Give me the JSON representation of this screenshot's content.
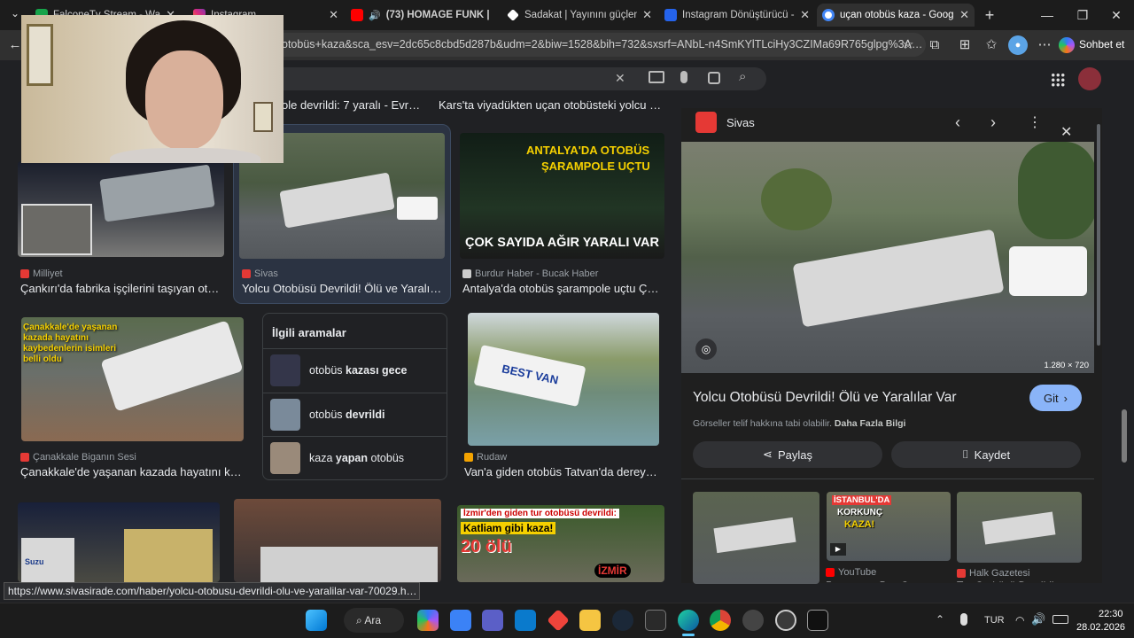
{
  "tabs": [
    {
      "title": "FalconeTv Stream - Watch L...",
      "color": "#16a34a"
    },
    {
      "title": "Instagram",
      "color": "#e1306c"
    },
    {
      "title": "(73) HOMAGE FUNK | T...",
      "color": "#ff0000"
    },
    {
      "title": "Sadakat | Yayınını güçlendirme...",
      "color": "#ffffff"
    },
    {
      "title": "Instagram Dönüştürücü - Insta...",
      "color": "#2563eb"
    },
    {
      "title": "uçan otobüs kaza - Google'da...",
      "color": "#4285f4"
    }
  ],
  "window_controls": {
    "minimize": "—",
    "maximize": "❐",
    "close": "✕"
  },
  "address": {
    "url": "otobüs+kaza&sca_esv=2dc65c8cbd5d287b&udm=2&biw=1528&bih=732&sxsrf=ANbL-n4SmKYlTLciHy3CZIMa69R765glpg%3A1772..."
  },
  "toolbar": {
    "sohbet_label": "Sohbet et"
  },
  "results_top": [
    {
      "title": "ole devrildi: 7 yaralı - Evre..."
    },
    {
      "title": "Kars'ta viyadükten uçan otobüsteki yolcu o a..."
    }
  ],
  "results": [
    {
      "source": "Milliyet",
      "title": "Çankırı'da fabrika işçilerini taşıyan otob...",
      "source_color": "#e53935"
    },
    {
      "source": "Sivas",
      "title": "Yolcu Otobüsü Devrildi! Ölü ve Yaralılar ...",
      "source_color": "#e53935"
    },
    {
      "source": "Burdur Haber - Bucak Haber",
      "title": "Antalya'da otobüs şarampole uçtu Çok ...",
      "source_color": "#cccccc"
    },
    {
      "source": "Çanakkale Biganın Sesi",
      "title": "Çanakkale'de yaşanan kazada hayatını kayb...",
      "source_color": "#e53935"
    },
    {
      "source": "Rudaw",
      "title": "Van'a giden otobüs Tatvan'da dereye u...",
      "source_color": "#f4a300"
    }
  ],
  "thumb_texts": {
    "antalya_top": "ANTALYA'DA OTOBÜS",
    "antalya_mid": "ŞARAMPOLE UÇTU",
    "antalya_bottom": "ÇOK SAYIDA AĞIR YARALI VAR",
    "canakkale": "Çanakkale'de yaşanan kazada hayatını kaybedenlerin isimleri belli oldu",
    "izmir_top": "İzmir'den giden tur otobüsü devrildi:",
    "izmir_mid": "Katliam gibi kaza!",
    "izmir_count": "20 ölü",
    "izmir_logo": "İZMİR",
    "van_bus": "BEST VAN",
    "suzu": "Suzu"
  },
  "related": {
    "heading": "İlgili aramalar",
    "items": [
      {
        "pre": "otobüs ",
        "bold": "kazası gece",
        "post": ""
      },
      {
        "pre": "otobüs ",
        "bold": "devrildi",
        "post": ""
      },
      {
        "pre": "kaza ",
        "bold": "yapan",
        "post": " otobüs"
      }
    ]
  },
  "panel": {
    "source": "Sivas",
    "dims": "1.280 × 720",
    "title": "Yolcu Otobüsü Devrildi! Ölü ve Yaralılar Var",
    "go_label": "Git",
    "copyright": "Görseller telif hakkına tabi olabilir.",
    "more_info": "Daha Fazla Bilgi",
    "share_label": "Paylaş",
    "save_label": "Kaydet",
    "related_sources": [
      "YouTube",
      "Halk Gazetesi"
    ],
    "related_titles": [
      "Passenger Bus Overtur...",
      "Tur Otobüsü Devrildi..."
    ],
    "thumb_overlay": [
      "İSTANBUL'DA",
      "KORKUNÇ",
      "KAZA!"
    ]
  },
  "status_url": "https://www.sivasirade.com/haber/yolcu-otobusu-devrildi-olu-ve-yaralilar-var-70029.html",
  "taskbar": {
    "search_label": "Ara",
    "lang": "TUR",
    "time": "22:30",
    "date": "28.02.2026"
  }
}
